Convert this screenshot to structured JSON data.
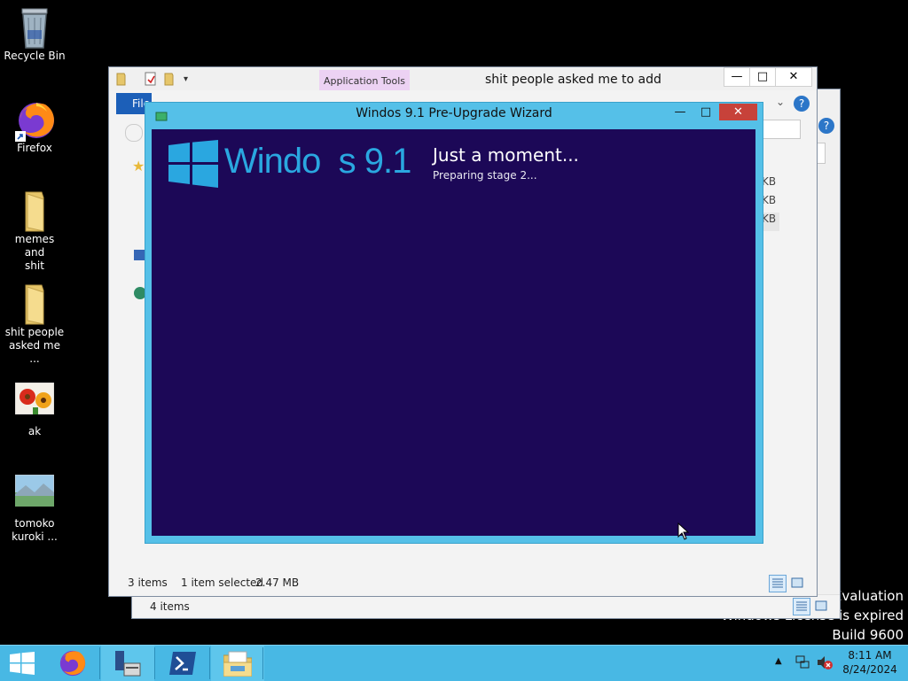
{
  "desktop": {
    "icons": [
      {
        "label": "Recycle Bin"
      },
      {
        "label": "Firefox"
      },
      {
        "label": "memes and\nshit"
      },
      {
        "label": "shit people\nasked me ..."
      },
      {
        "label": "ak"
      },
      {
        "label": "tomoko\nkuroki ..."
      }
    ],
    "watermark": {
      "line1": "Evaluation",
      "line2": "Windows License is expired",
      "line3": "Build 9600"
    }
  },
  "explorer_back": {
    "status_items": "4 items"
  },
  "explorer_front": {
    "title": "shit people asked me to add",
    "context_tab": "Application Tools",
    "file_tab": "File",
    "search_placeholder": "...",
    "sizes": [
      "KB",
      "KB",
      "KB"
    ],
    "status_items": "3 items",
    "status_selected": "1 item selected",
    "status_size": "2.47 MB"
  },
  "wizard": {
    "title": "Windos 9.1 Pre-Upgrade Wizard",
    "logo_text": "Windo  s 9.1",
    "heading": "Just a moment...",
    "subheading": "Preparing stage 2..."
  },
  "taskbar": {
    "clock_time": "8:11 AM",
    "clock_date": "8/24/2024"
  },
  "colors": {
    "wizard_bg": "#1c0857",
    "wizard_frame": "#55c0e8",
    "logo": "#2aa7e0",
    "taskbar": "#48b8e4",
    "context_tab": "#e8c8f0"
  }
}
